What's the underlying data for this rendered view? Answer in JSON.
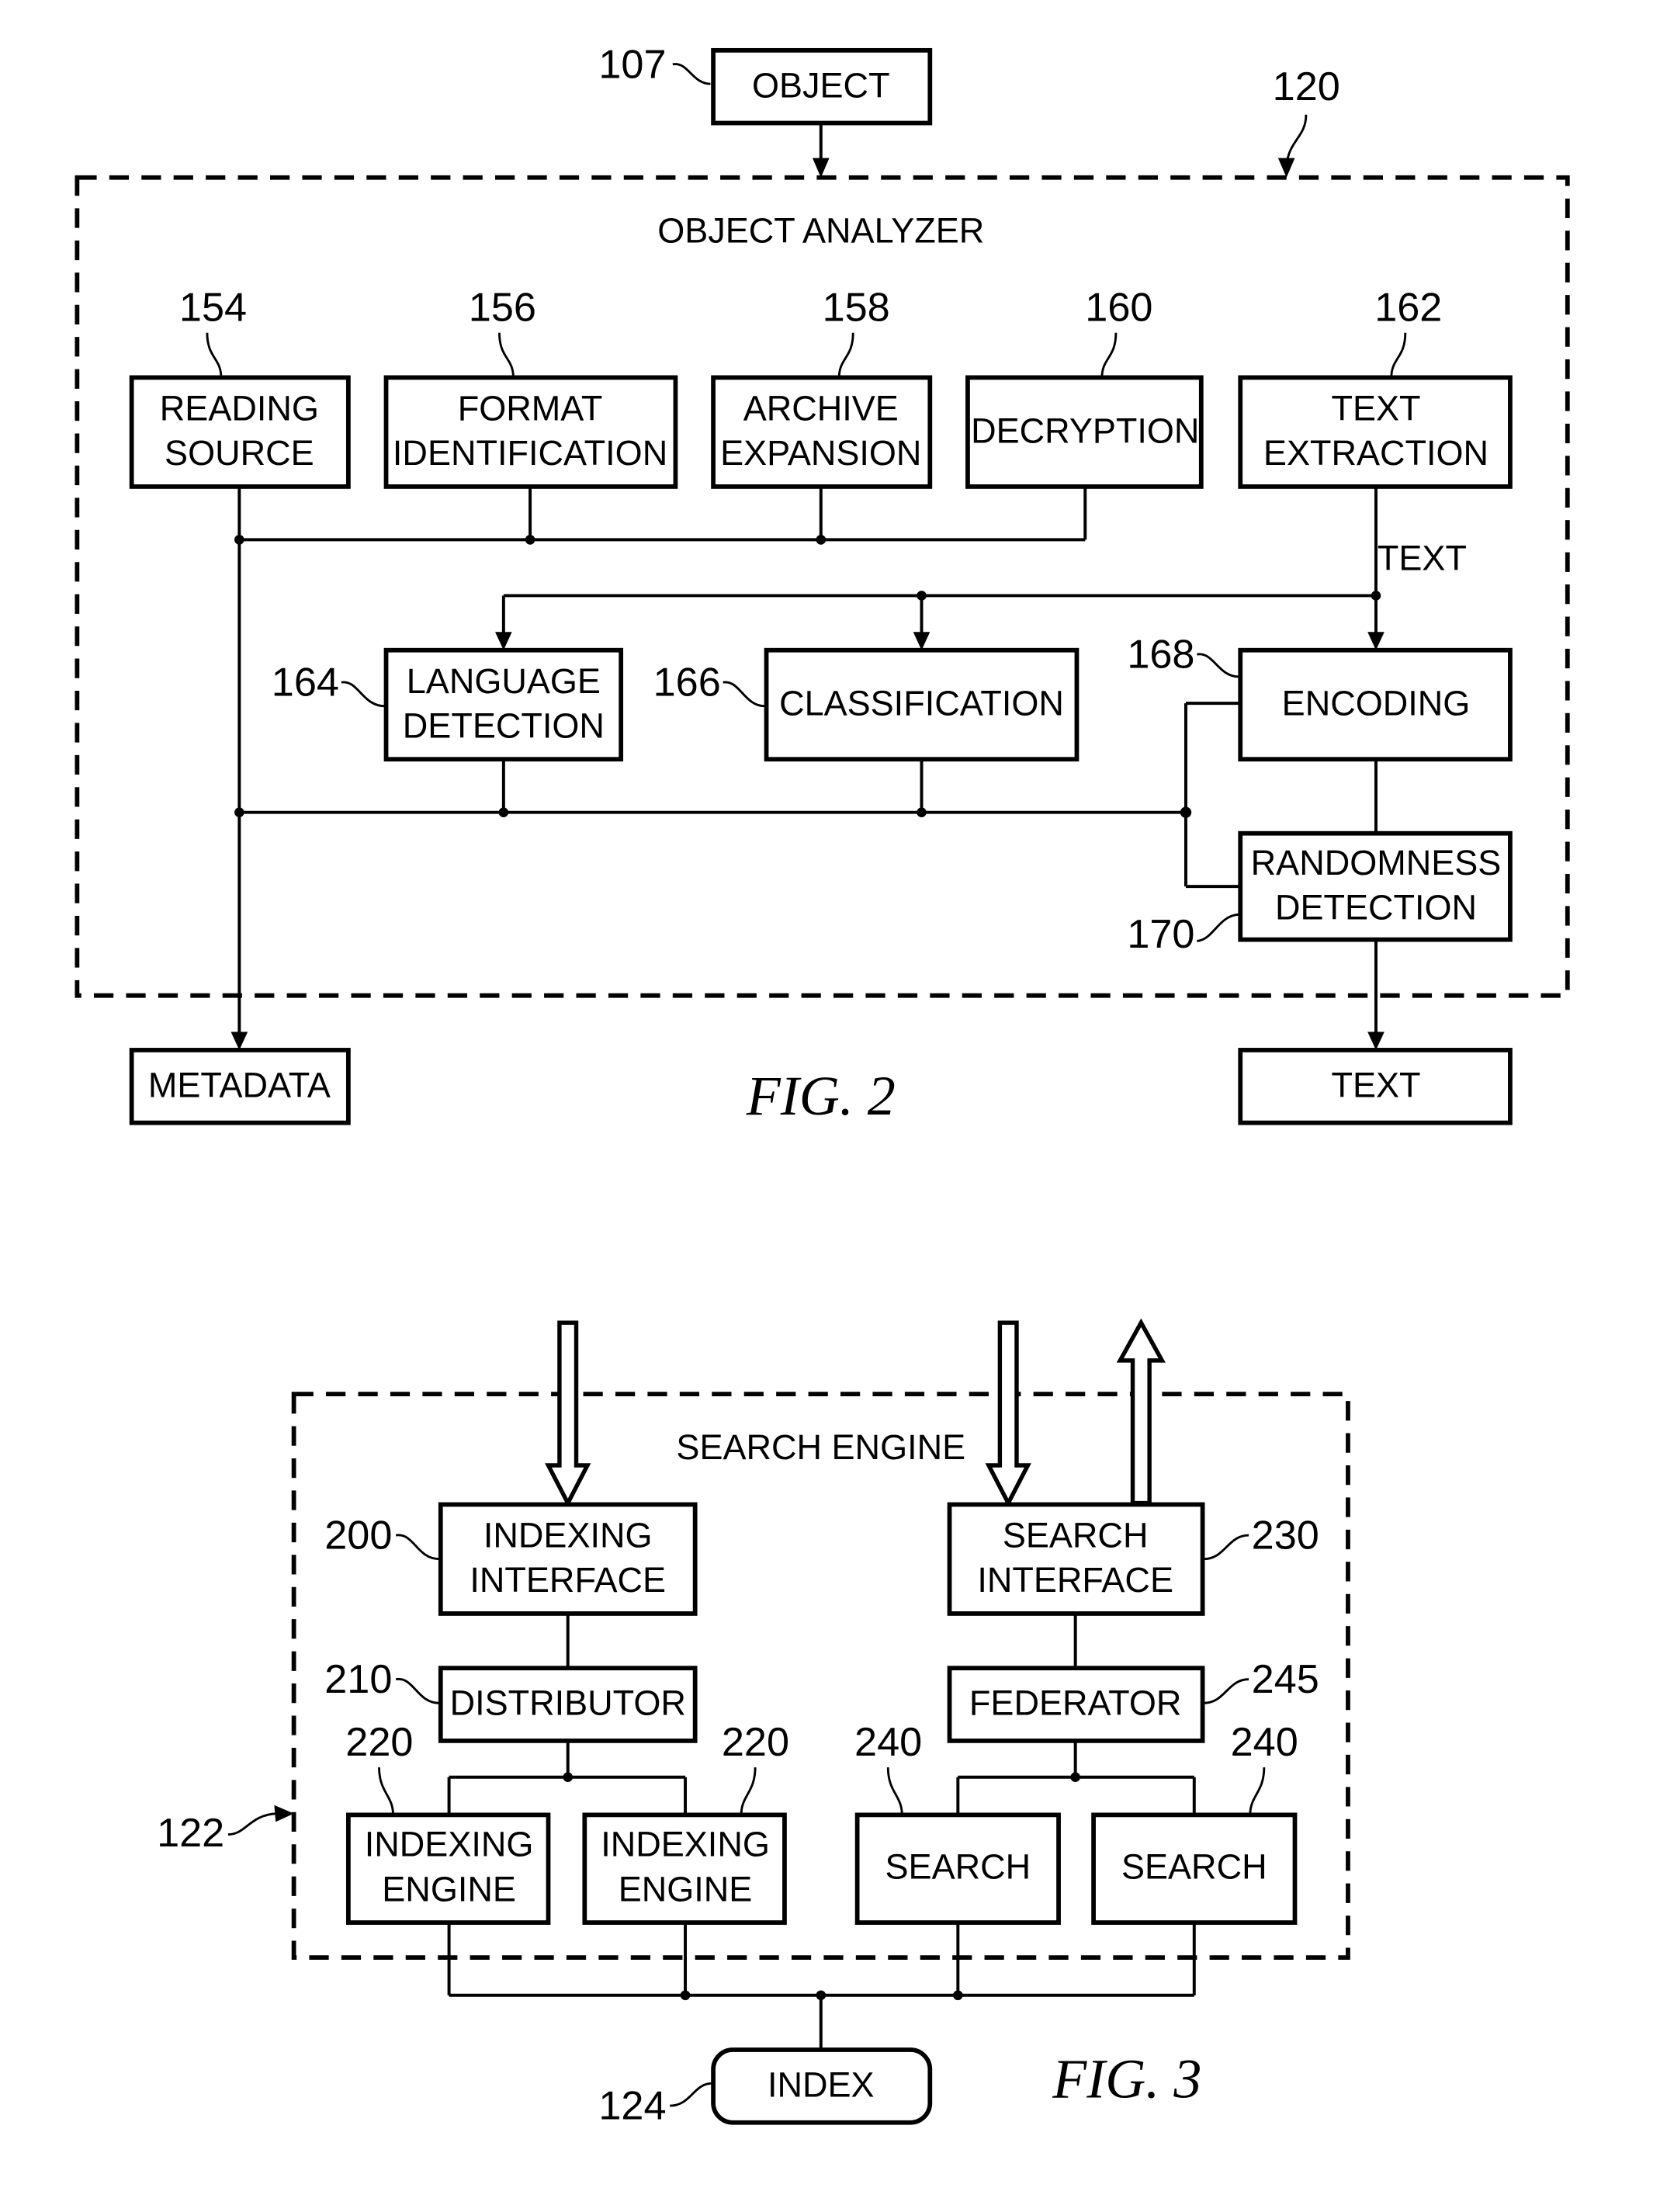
{
  "fig2": {
    "caption": "FIG. 2",
    "container": {
      "title": "OBJECT ANALYZER",
      "ref": "120"
    },
    "input": {
      "label": "OBJECT",
      "ref": "107"
    },
    "modules": [
      {
        "id": "reading-source",
        "line1": "READING",
        "line2": "SOURCE",
        "ref": "154"
      },
      {
        "id": "format-identification",
        "line1": "FORMAT",
        "line2": "IDENTIFICATION",
        "ref": "156"
      },
      {
        "id": "archive-expansion",
        "line1": "ARCHIVE",
        "line2": "EXPANSION",
        "ref": "158"
      },
      {
        "id": "decryption",
        "line1": "DECRYPTION",
        "line2": "",
        "ref": "160"
      },
      {
        "id": "text-extraction",
        "line1": "TEXT",
        "line2": "EXTRACTION",
        "ref": "162"
      },
      {
        "id": "language-detection",
        "line1": "LANGUAGE",
        "line2": "DETECTION",
        "ref": "164"
      },
      {
        "id": "classification",
        "line1": "CLASSIFICATION",
        "line2": "",
        "ref": "166"
      },
      {
        "id": "encoding",
        "line1": "ENCODING",
        "line2": "",
        "ref": "168"
      },
      {
        "id": "randomness-detection",
        "line1": "RANDOMNESS",
        "line2": "DETECTION",
        "ref": "170"
      }
    ],
    "text_wire_label": "TEXT",
    "outputs": {
      "metadata": "METADATA",
      "text": "TEXT"
    }
  },
  "fig3": {
    "caption": "FIG. 3",
    "container": {
      "title": "SEARCH ENGINE",
      "ref": "122"
    },
    "modules": [
      {
        "id": "indexing-interface",
        "line1": "INDEXING",
        "line2": "INTERFACE",
        "ref": "200"
      },
      {
        "id": "distributor",
        "line1": "DISTRIBUTOR",
        "line2": "",
        "ref": "210"
      },
      {
        "id": "indexing-engine-1",
        "line1": "INDEXING",
        "line2": "ENGINE",
        "ref": "220"
      },
      {
        "id": "indexing-engine-2",
        "line1": "INDEXING",
        "line2": "ENGINE",
        "ref": "220"
      },
      {
        "id": "search-interface",
        "line1": "SEARCH",
        "line2": "INTERFACE",
        "ref": "230"
      },
      {
        "id": "federator",
        "line1": "FEDERATOR",
        "line2": "",
        "ref": "245"
      },
      {
        "id": "search-1",
        "line1": "SEARCH",
        "line2": "",
        "ref": "240"
      },
      {
        "id": "search-2",
        "line1": "SEARCH",
        "line2": "",
        "ref": "240"
      }
    ],
    "index": {
      "label": "INDEX",
      "ref": "124"
    }
  }
}
